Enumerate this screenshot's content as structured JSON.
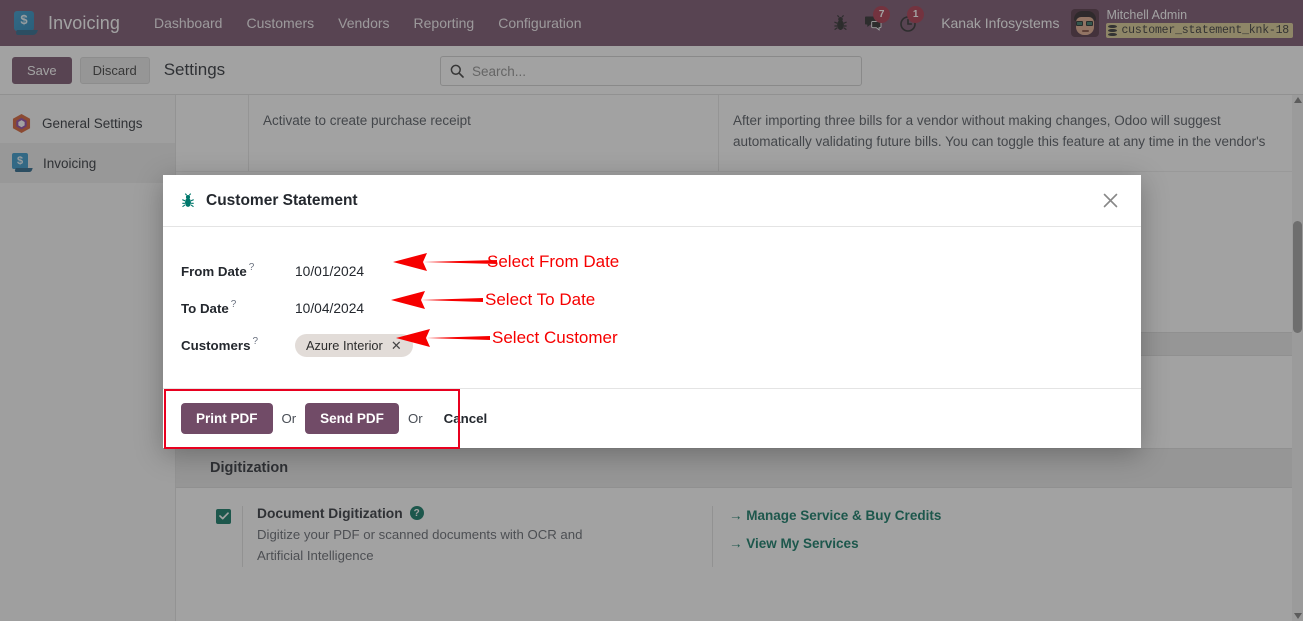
{
  "navbar": {
    "brand": "Invoicing",
    "menu": [
      "Dashboard",
      "Customers",
      "Vendors",
      "Reporting",
      "Configuration"
    ],
    "bug_icon": "bug-icon",
    "messages_badge": "7",
    "activities_badge": "1",
    "company": "Kanak Infosystems",
    "user_name": "Mitchell Admin",
    "database": "customer_statement_knk-18"
  },
  "control_panel": {
    "save_label": "Save",
    "discard_label": "Discard",
    "title": "Settings",
    "search_placeholder": "Search...",
    "search_value": ""
  },
  "sidebar": {
    "items": [
      {
        "label": "General Settings",
        "icon": "hexagon-icon",
        "active": false
      },
      {
        "label": "Invoicing",
        "icon": "invoicing-icon",
        "active": true
      }
    ]
  },
  "background": {
    "purchase_receipt_text": "Activate to create purchase receipt",
    "vendor_bills_text": "After importing three bills for a vendor without making changes, Odoo will suggest automatically validating future bills. You can toggle this feature at any time in the vendor's",
    "digitization_section": "Digitization",
    "digitization": {
      "title": "Document Digitization",
      "checked": true,
      "help_icon": "question-mark-icon",
      "description": "Digitize your PDF or scanned documents with OCR and Artificial Intelligence",
      "links": [
        "→ Manage Service & Buy Credits",
        "→ View My Services"
      ]
    }
  },
  "modal": {
    "icon": "bug-icon",
    "title": "Customer Statement",
    "close_icon": "close-icon",
    "fields": [
      {
        "label": "From Date",
        "help": "?",
        "value": "10/01/2024"
      },
      {
        "label": "To Date",
        "help": "?",
        "value": "10/04/2024"
      }
    ],
    "customers_label": "Customers",
    "customers_help": "?",
    "customers_tags": [
      "Azure Interior"
    ],
    "tag_remove_icon": "close-icon",
    "footer": {
      "print_label": "Print PDF",
      "or_1": "Or",
      "send_label": "Send PDF",
      "or_2": "Or",
      "cancel_label": "Cancel"
    }
  },
  "annotations": {
    "color": "#f60000",
    "items": [
      {
        "text": "Select From Date"
      },
      {
        "text": "Select To Date"
      },
      {
        "text": "Select Customer"
      }
    ]
  },
  "colors": {
    "primary": "#714B67",
    "accent_teal": "#00705B",
    "badge_red": "#a52B42",
    "annotation_red": "#f60000"
  }
}
